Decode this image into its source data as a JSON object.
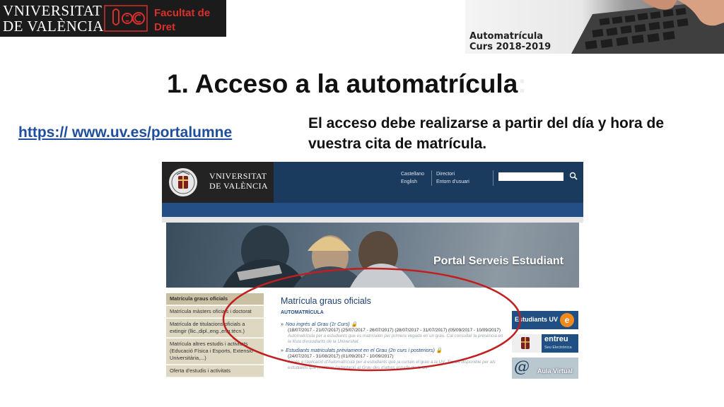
{
  "header": {
    "university_line1": "VNIVERSITAT",
    "university_line2": "DE VALÈNCIA",
    "faculty_line1": "Facultat de",
    "faculty_line2": "Dret",
    "banner_line1": "Automatrícula",
    "banner_line2": "Curs 2018-2019"
  },
  "title": {
    "text": "1. Acceso a la automatrícula",
    "ghost": ":"
  },
  "link": {
    "text": "https:// www.uv.es/portalumne"
  },
  "note": {
    "text": "El acceso debe realizarse a partir del día y hora de vuestra cita de matrícula."
  },
  "screenshot": {
    "logo_line1": "VNIVERSITAT",
    "logo_line2": "DE VALÈNCIA",
    "lang_castellano": "Castellano",
    "lang_english": "English",
    "nav_directori": "Directori",
    "nav_entorn": "Entorn d'usuari",
    "hero_title": "Portal Serveis Estudiant",
    "sidebar": [
      {
        "label": "Matrícula graus oficials",
        "active": true
      },
      {
        "label": "Matrícula màsters oficials i doctorat",
        "active": false
      },
      {
        "label": "Matrícula de titulacions oficials a extingir (llic.,dipl.,eng.,eng.tècn.)",
        "active": false
      },
      {
        "label": "Matrícula altres estudis i activitats (Educació Física i Esports, Extensió Universitària,...)",
        "active": false
      },
      {
        "label": "Oferta d'estudis i activitats",
        "active": false
      }
    ],
    "main_title": "Matrícula graus oficials",
    "main_subtitle": "AUTOMATRÍCULA",
    "entries": [
      {
        "head": "Nou ingrés al Grau (1r Curs)",
        "dates": "(18/07/2017 - 21/07/2017) (25/07/2017 - 26/07/2017) (28/07/2017 - 31/07/2017) (05/09/2017 - 10/09/2017)",
        "desc": "Automatrícula per a estudiants que es matriculen per primera vegada en un grau. Cal consultar la presència en la llista d'estudiants de la Universitat."
      },
      {
        "head": "Estudiants matriculats prèviament en el Grau (2n curs i posteriors)",
        "dates": "(24/07/2017 - 31/08/2017) (01/09/2017 - 10/09/2017)",
        "desc": "Accés a l'aplicació d'Automatrícula per a estudiants que ja cursen el grau a la UV. També disponible per als estudiants que realitzen l'adaptació al Grau des d'altres estudis de la UV."
      }
    ],
    "badge_estudiants": "Estudiants UV",
    "badge_estudiants_e": "e",
    "badge_entreu": "entreu",
    "badge_entreu_sub": "Seu Electrònica",
    "badge_aula_at": "@",
    "badge_aula": "Aula Virtual"
  },
  "colors": {
    "link": "#1f4e9e",
    "faculty_red": "#d9302c",
    "portal_navy": "#1a3a5e",
    "portal_blue": "#244e86",
    "highlight_red": "#c01f1f"
  }
}
